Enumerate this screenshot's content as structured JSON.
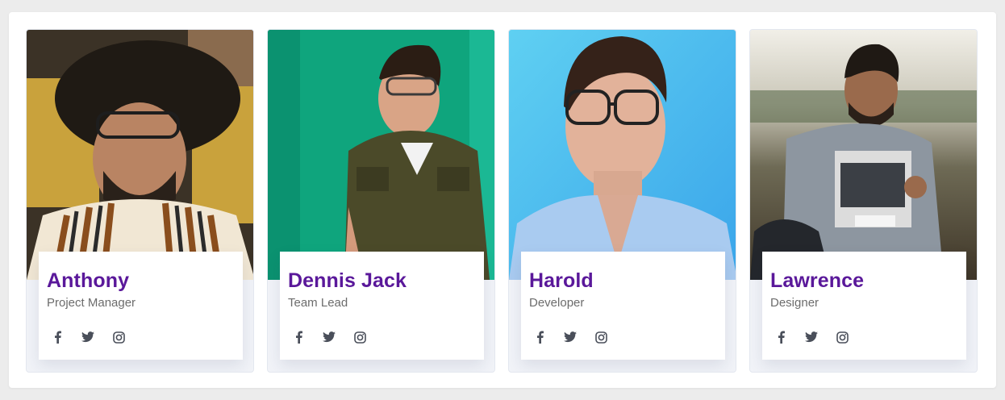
{
  "team": [
    {
      "name": "Anthony",
      "role": "Project Manager",
      "photo_icon": "portrait-photo",
      "social": [
        "facebook-icon",
        "twitter-icon",
        "instagram-icon"
      ]
    },
    {
      "name": "Dennis Jack",
      "role": "Team Lead",
      "photo_icon": "portrait-photo",
      "social": [
        "facebook-icon",
        "twitter-icon",
        "instagram-icon"
      ]
    },
    {
      "name": "Harold",
      "role": "Developer",
      "photo_icon": "portrait-photo",
      "social": [
        "facebook-icon",
        "twitter-icon",
        "instagram-icon"
      ]
    },
    {
      "name": "Lawrence",
      "role": "Designer",
      "photo_icon": "portrait-photo",
      "social": [
        "facebook-icon",
        "twitter-icon",
        "instagram-icon"
      ]
    }
  ],
  "colors": {
    "page_bg": "#ececec",
    "panel_bg": "#ffffff",
    "name": "#5a189a",
    "role": "#6c6c6c",
    "icon": "#4a4f5a",
    "card_bg": "#f1f3f8"
  }
}
